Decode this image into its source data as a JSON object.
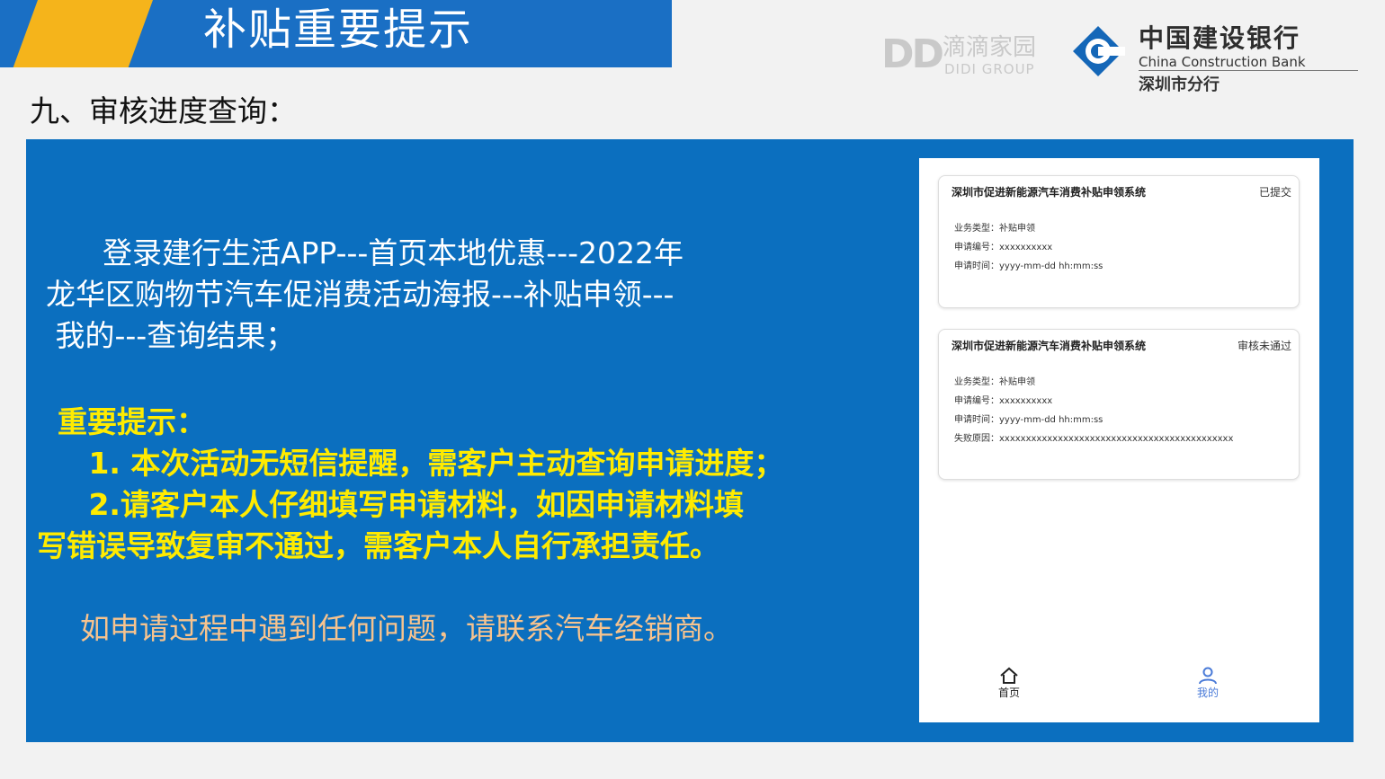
{
  "header": {
    "title": "补贴重要提示",
    "accent_color": "#f5b41b",
    "bar_color": "#1a6fc4"
  },
  "logos": {
    "didi": {
      "mark": "DD",
      "name_cn": "滴滴家园",
      "name_en": "DIDI GROUP"
    },
    "ccb": {
      "name_cn": "中国建设银行",
      "name_en": "China Construction Bank",
      "branch": "深圳市分行",
      "icon": "ccb-logo-icon"
    }
  },
  "section": {
    "heading": "九、审核进度查询："
  },
  "instructions": {
    "lines": [
      "      登录建行生活APP---首页本地优惠---2022年",
      "龙华区购物节汽车促消费活动海报---补贴申领---",
      " 我的---查询结果；"
    ]
  },
  "tips": {
    "heading": "  重要提示：",
    "item1": "     1. 本次活动无短信提醒，需客户主动查询申请进度；",
    "item2_line1": "     2.请客户本人仔细填写申请材料，如因申请材料填",
    "item2_line2": "写错误导致复审不通过，需客户本人自行承担责任。"
  },
  "contact": {
    "text": "如申请过程中遇到任何问题，请联系汽车经销商。"
  },
  "phone": {
    "cards": [
      {
        "title": "深圳市促进新能源汽车消费补贴申领系统",
        "status": "已提交",
        "rows": [
          {
            "label": "业务类型：",
            "value": "补贴申领"
          },
          {
            "label": "申请编号：",
            "value": "xxxxxxxxxx"
          },
          {
            "label": "申请时间：",
            "value": "yyyy-mm-dd hh:mm:ss"
          }
        ]
      },
      {
        "title": "深圳市促进新能源汽车消费补贴申领系统",
        "status": "审核未通过",
        "rows": [
          {
            "label": "业务类型：",
            "value": "补贴申领"
          },
          {
            "label": "申请编号：",
            "value": "xxxxxxxxxx"
          },
          {
            "label": "申请时间：",
            "value": "yyyy-mm-dd hh:mm:ss"
          },
          {
            "label": "失败原因：",
            "value": "xxxxxxxxxxxxxxxxxxxxxxxxxxxxxxxxxxxxxxxxxxxx"
          }
        ]
      }
    ],
    "tabs": [
      {
        "label": "首页",
        "icon": "home-icon"
      },
      {
        "label": "我的",
        "icon": "user-icon",
        "active_color": "#4a7bd8"
      }
    ]
  }
}
